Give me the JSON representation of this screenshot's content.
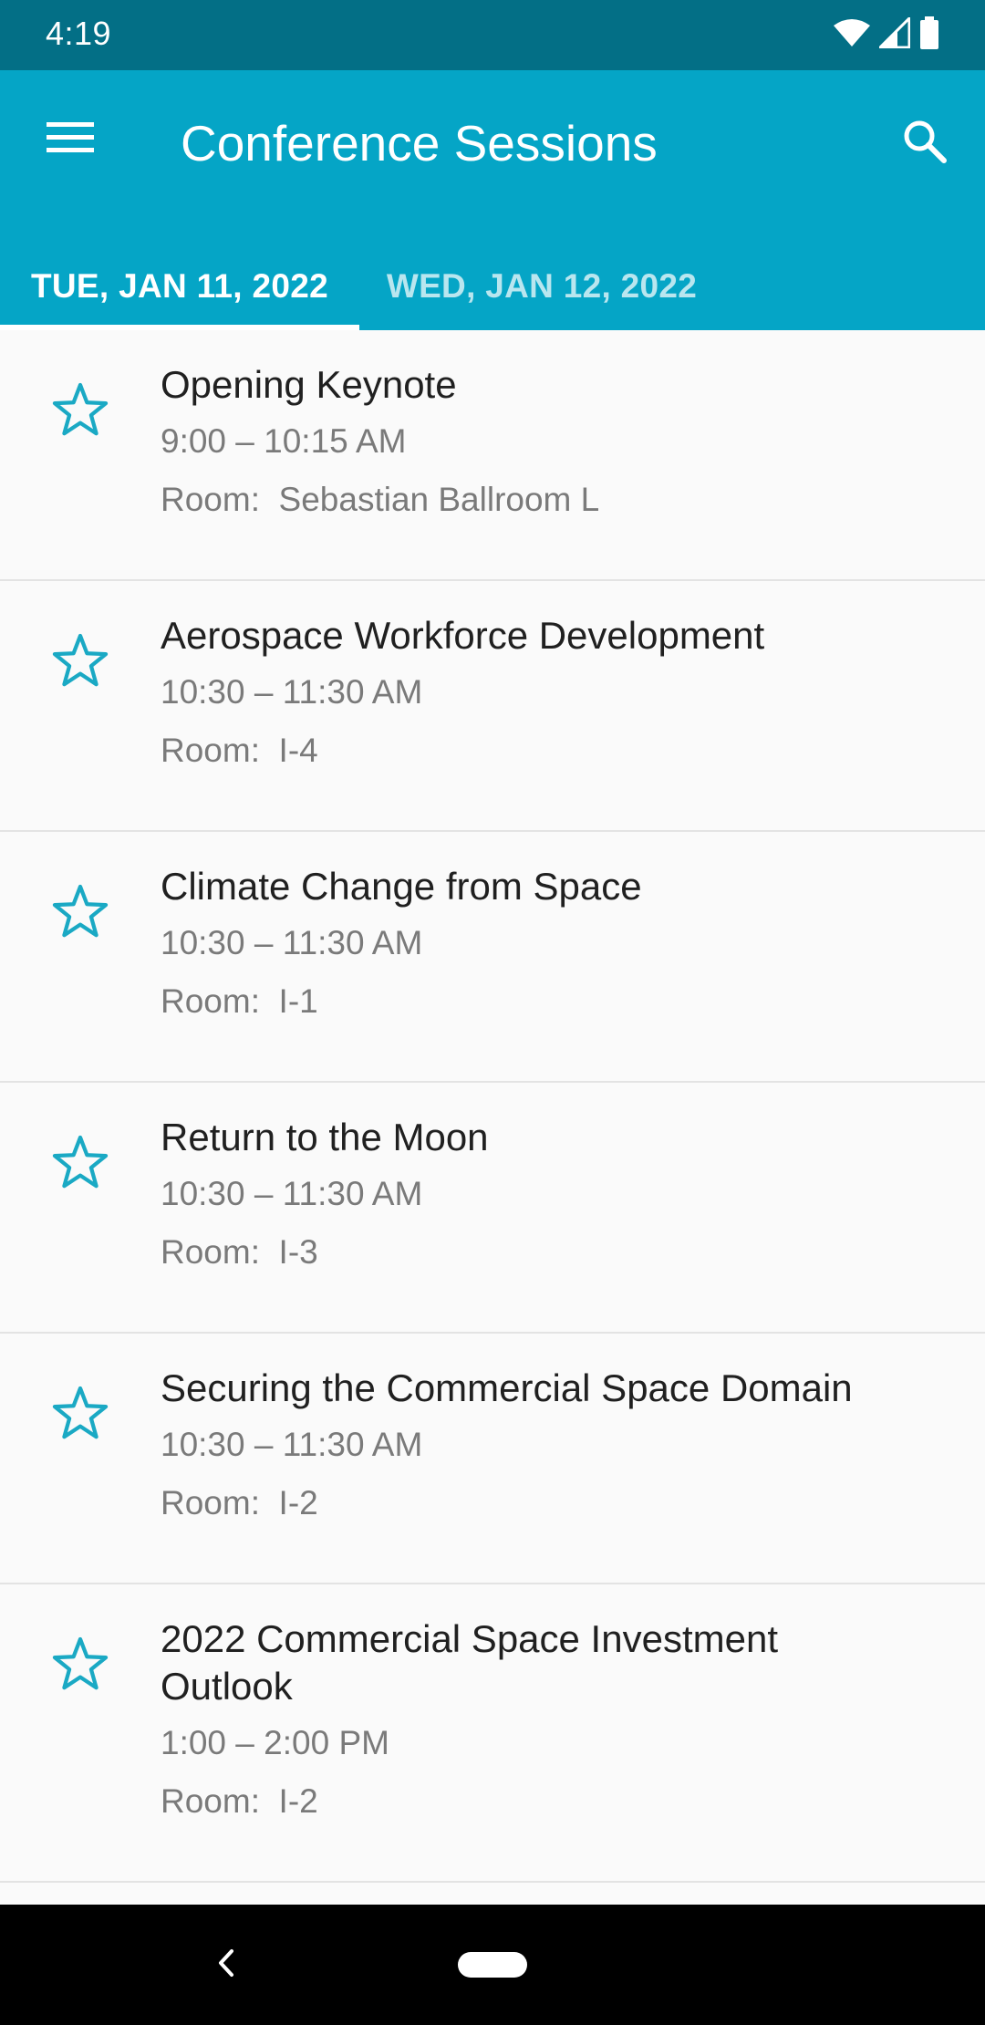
{
  "status_bar": {
    "time": "4:19",
    "icons": [
      "wifi-icon",
      "signal-icon",
      "battery-icon"
    ]
  },
  "app_bar": {
    "title": "Conference Sessions",
    "menu_icon": "menu-icon",
    "search_icon": "search-icon"
  },
  "tabs": [
    {
      "label": "TUE, JAN 11, 2022",
      "selected": true
    },
    {
      "label": "WED, JAN 12, 2022",
      "selected": false
    }
  ],
  "sessions": [
    {
      "title": "Opening Keynote",
      "time": "9:00 – 10:15 AM",
      "room": "Room:  Sebastian Ballroom L",
      "starred": false
    },
    {
      "title": "Aerospace Workforce Development",
      "time": "10:30 – 11:30 AM",
      "room": "Room:  I-4",
      "starred": false
    },
    {
      "title": "Climate Change from Space",
      "time": "10:30 – 11:30 AM",
      "room": "Room:  I-1",
      "starred": false
    },
    {
      "title": "Return to the Moon",
      "time": "10:30 – 11:30 AM",
      "room": "Room:  I-3",
      "starred": false
    },
    {
      "title": "Securing the Commercial Space Domain",
      "time": "10:30 – 11:30 AM",
      "room": "Room:  I-2",
      "starred": false
    },
    {
      "title": "2022 Commercial Space Investment Outlook",
      "time": "1:00 – 2:00 PM",
      "room": "Room:  I-2",
      "starred": false
    }
  ],
  "colors": {
    "status_bar": "#036f86",
    "app_bar": "#05a5c6",
    "star_outline": "#1aa9c4",
    "list_background": "#fafafa"
  },
  "nav_bar": {
    "back_icon": "back-chevron-icon",
    "home_icon": "home-pill-icon"
  }
}
